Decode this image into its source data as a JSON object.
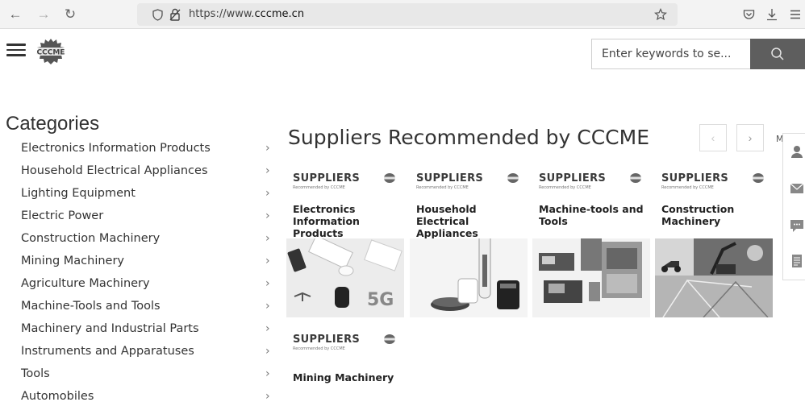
{
  "browser": {
    "url_prefix": "https://www.",
    "url_domain": "cccme.cn"
  },
  "header": {
    "logo_text": "CCCME",
    "search_placeholder": "Enter keywords to se..."
  },
  "categories": {
    "title": "Categories",
    "items": [
      {
        "label": "Electronics Information Products"
      },
      {
        "label": "Household Electrical Appliances"
      },
      {
        "label": "Lighting Equipment"
      },
      {
        "label": "Electric Power"
      },
      {
        "label": "Construction Machinery"
      },
      {
        "label": "Mining Machinery"
      },
      {
        "label": "Agriculture Machinery"
      },
      {
        "label": "Machine-Tools and Tools"
      },
      {
        "label": "Machinery and Industrial Parts"
      },
      {
        "label": "Instruments and Apparatuses"
      },
      {
        "label": "Tools"
      },
      {
        "label": "Automobiles"
      }
    ],
    "arrow_glyph": "›"
  },
  "suppliers": {
    "title": "Suppliers Recommended by CCCME",
    "prev_glyph": "‹",
    "next_glyph": "›",
    "more_label": "M",
    "brand": "SUPPLIERS",
    "brand_sub": "Recommended by CCCME",
    "cards": [
      {
        "name": "Electronics Information Products",
        "icon": "electronics-photo"
      },
      {
        "name": "Household Electrical Appliances",
        "icon": "appliances-photo"
      },
      {
        "name": "Machine-tools and Tools",
        "icon": "machine-tools-photo"
      },
      {
        "name": "Construction Machinery",
        "icon": "construction-photo"
      },
      {
        "name": "Mining Machinery",
        "icon": "mining-photo"
      }
    ]
  },
  "photo_text": {
    "fiveg": "5G"
  },
  "float_bar": {
    "icons": [
      "contact-icon",
      "mail-icon",
      "chat-icon",
      "document-icon"
    ]
  }
}
